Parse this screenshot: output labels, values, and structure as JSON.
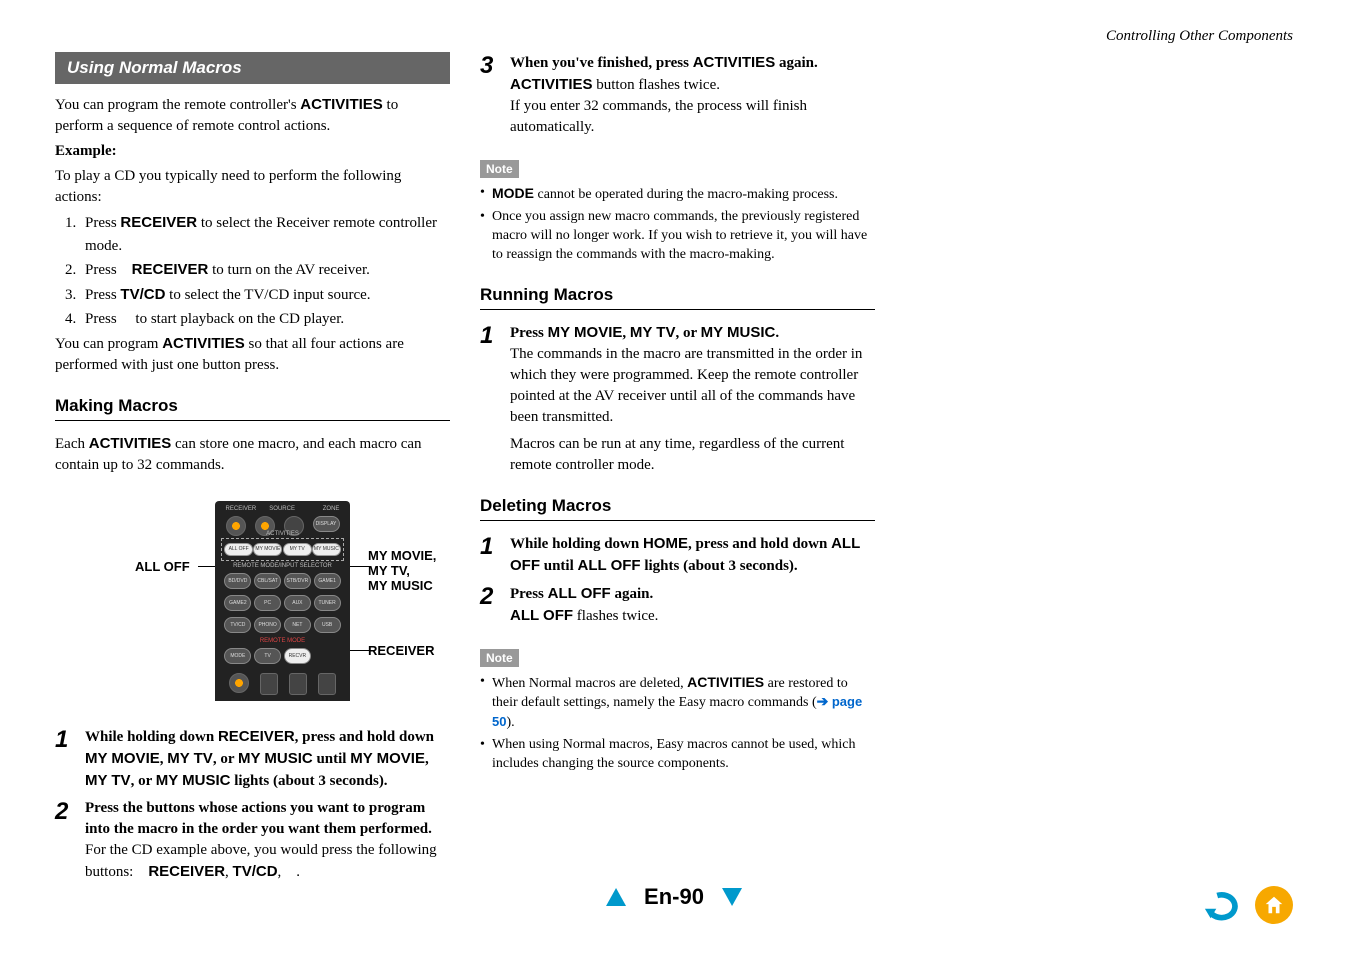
{
  "header": {
    "section_title": "Controlling Other Components"
  },
  "col1": {
    "section_bar": "Using Normal Macros",
    "intro1a": "You can program the remote controller's ",
    "intro1b": "ACTIVITIES",
    "intro1c": " to perform a sequence of remote control actions.",
    "example_label": "Example:",
    "example_intro": "To play a CD you typically need to perform the following actions:",
    "list1": {
      "item1a": "Press ",
      "item1b": "RECEIVER",
      "item1c": " to select the Receiver remote controller mode.",
      "item2a": "Press ",
      "item2b": "RECEIVER",
      "item2c": " to turn on the AV receiver.",
      "item3a": "Press ",
      "item3b": "TV/CD",
      "item3c": " to select the TV/CD input source.",
      "item4a": "Press ",
      "item4b": " to start playback on the CD player."
    },
    "post1a": "You can program ",
    "post1b": "ACTIVITIES",
    "post1c": " so that all four actions are performed with just one button press.",
    "making_heading": "Making Macros",
    "making_body1a": "Each ",
    "making_body1b": "ACTIVITIES",
    "making_body1c": " can store one macro, and each macro can contain up to 32 commands.",
    "callouts": {
      "alloff": "ALL OFF",
      "mymovie": "MY MOVIE,",
      "mytv": "MY TV,",
      "mymusic": "MY MUSIC",
      "receiver": "RECEIVER"
    },
    "step1": {
      "title1": "While holding down ",
      "title2": "RECEIVER",
      "title3": ", press and hold down ",
      "title4": "MY MOVIE",
      "title5": ", ",
      "title6": "MY TV",
      "title7": ", or ",
      "title8": "MY MUSIC",
      "title9": " until ",
      "title10": "MY MOVIE",
      "title11": ", ",
      "title12": "MY TV",
      "title13": ", or ",
      "title14": "MY MUSIC",
      "title15": " lights (about 3 seconds)."
    },
    "step2": {
      "title": "Press the buttons whose actions you want to program into the macro in the order you want them performed.",
      "body1": "For the CD example above, you would press the following buttons: ",
      "body2": "RECEIVER",
      "body3": ", ",
      "body4": "TV/CD",
      "body5": ", "
    }
  },
  "col2": {
    "step3": {
      "title1": "When you've finished, press ",
      "title2": "ACTIVITIES",
      "title3": " again.",
      "body1a": "ACTIVITIES",
      "body1b": " button flashes twice.",
      "body2": "If you enter 32 commands, the process will finish automatically."
    },
    "note1_label": "Note",
    "note1_items": {
      "i1a": "MODE",
      "i1b": " cannot be operated during the macro-making process.",
      "i2": "Once you assign new macro commands, the previously registered macro will no longer work. If you wish to retrieve it, you will have to reassign the commands with the macro-making."
    },
    "running_heading": "Running Macros",
    "running_step1": {
      "title1": "Press ",
      "title2": "MY MOVIE",
      "title3": ", ",
      "title4": "MY TV",
      "title5": ", or ",
      "title6": "MY MUSIC",
      "title7": ".",
      "body1": "The commands in the macro are transmitted in the order in which they were programmed. Keep the remote controller pointed at the AV receiver until all of the commands have been transmitted.",
      "body2": "Macros can be run at any time, regardless of the current remote controller mode."
    },
    "deleting_heading": "Deleting Macros",
    "deleting_step1": {
      "title1": "While holding down ",
      "title2": "HOME",
      "title3": ", press and hold down ",
      "title4": "ALL OFF",
      "title5": " until ",
      "title6": "ALL OFF",
      "title7": " lights (about 3 seconds)."
    },
    "deleting_step2": {
      "title1": "Press ",
      "title2": "ALL OFF",
      "title3": " again.",
      "body1a": "ALL OFF",
      "body1b": " flashes twice."
    },
    "note2_label": "Note",
    "note2_items": {
      "i1a": "When Normal macros are deleted, ",
      "i1b": "ACTIVITIES",
      "i1c": " are restored to their default settings, namely the Easy macro commands (",
      "i1d": "page 50",
      "i1e": ").",
      "i2": "When using Normal macros, Easy macros cannot be used, which includes changing the source components."
    }
  },
  "footer": {
    "page": "En-90"
  }
}
